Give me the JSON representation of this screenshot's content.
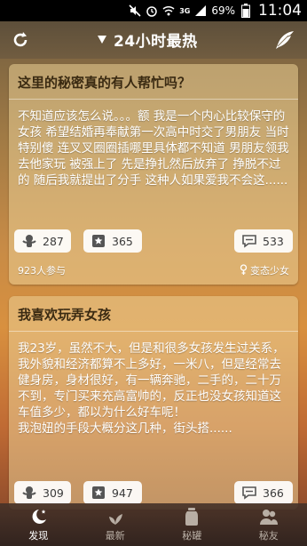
{
  "status_bar": {
    "network": "3G",
    "battery": "69%",
    "time": "11:04"
  },
  "app_bar": {
    "title": "24小时最热",
    "icons": [
      "refresh-icon",
      "dropdown-triangle-icon",
      "feather-pen-icon"
    ]
  },
  "cards": [
    {
      "title": "这里的秘密真的有人帮忙吗？",
      "body": "不知道应该怎么说。。。额 我是一个内心比较保守的女孩 希望结婚再奉献第一次高中时交了男朋友 当时特别傻 连叉叉圈圈插哪里具体都不知道 男朋友领我去他家玩 被强上了 先是挣扎然后放弃了 挣脱不过的 随后我就提出了分手 这种人如果爱我不会这......",
      "hug_count": "287",
      "vote_count": "365",
      "comment_count": "533",
      "participants": "923人参与",
      "author": "变态少女"
    },
    {
      "title": "我喜欢玩弄女孩",
      "body": "我23岁，虽然不大，但是和很多女孩发生过关系，我外貌和经济都算不上多好，一米八，但是经常去健身房，身材很好，有一辆奔驰，二手的，二十万不到，专门买来充高富帅的，反正也没女孩知道这车值多少，都以为什么好车呢！\n我泡妞的手段大概分这几种，街头搭......",
      "hug_count": "309",
      "vote_count": "947",
      "comment_count": "366"
    }
  ],
  "bottom_nav": [
    {
      "label": "发现",
      "icon": "moon-star-icon",
      "active": true
    },
    {
      "label": "最新",
      "icon": "leaf-icon",
      "active": false
    },
    {
      "label": "秘罐",
      "icon": "jar-icon",
      "active": false
    },
    {
      "label": "秘友",
      "icon": "friends-icon",
      "active": false
    }
  ],
  "colors": {
    "status_bar_bg": "#000000",
    "app_bar_bg": "#5c4e3a",
    "card_bg": "#ebd096",
    "card_title": "#3a2a12",
    "pill_bg": "#ffffff"
  }
}
